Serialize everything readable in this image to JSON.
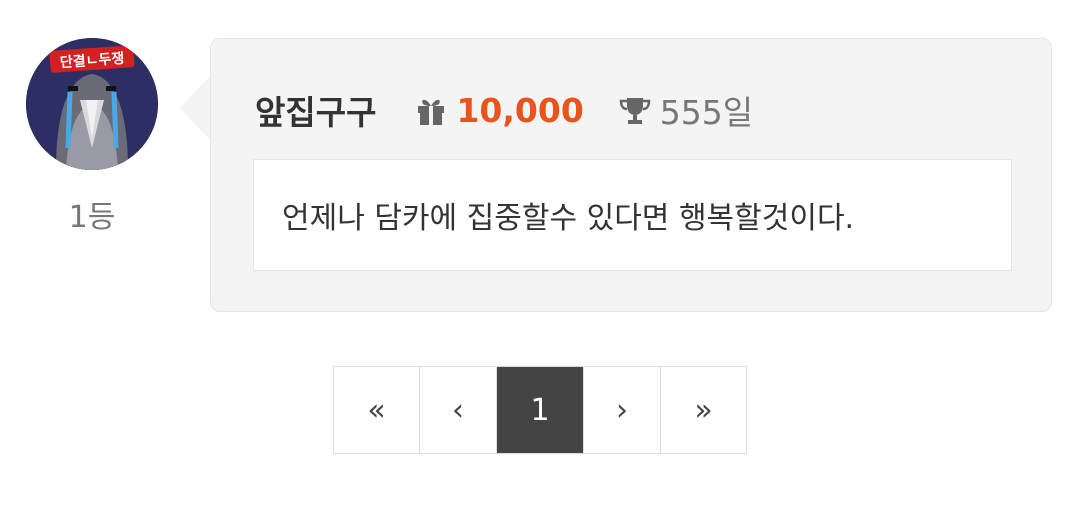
{
  "comment": {
    "rank_label": "1등",
    "username": "앞집구구",
    "points": "10,000",
    "days": "555일",
    "message": "언제나 담카에 집중할수 있다면 행복할것이다.",
    "avatar_banner_text": "단결ㄴ두쟁",
    "gift_icon": "gift-icon",
    "trophy_icon": "trophy-icon"
  },
  "pagination": {
    "first": "«",
    "prev": "‹",
    "current": "1",
    "next": "›",
    "last": "»"
  },
  "colors": {
    "points": "#e8541a",
    "bubble_bg": "#f4f4f4",
    "active_page_bg": "#444444"
  }
}
